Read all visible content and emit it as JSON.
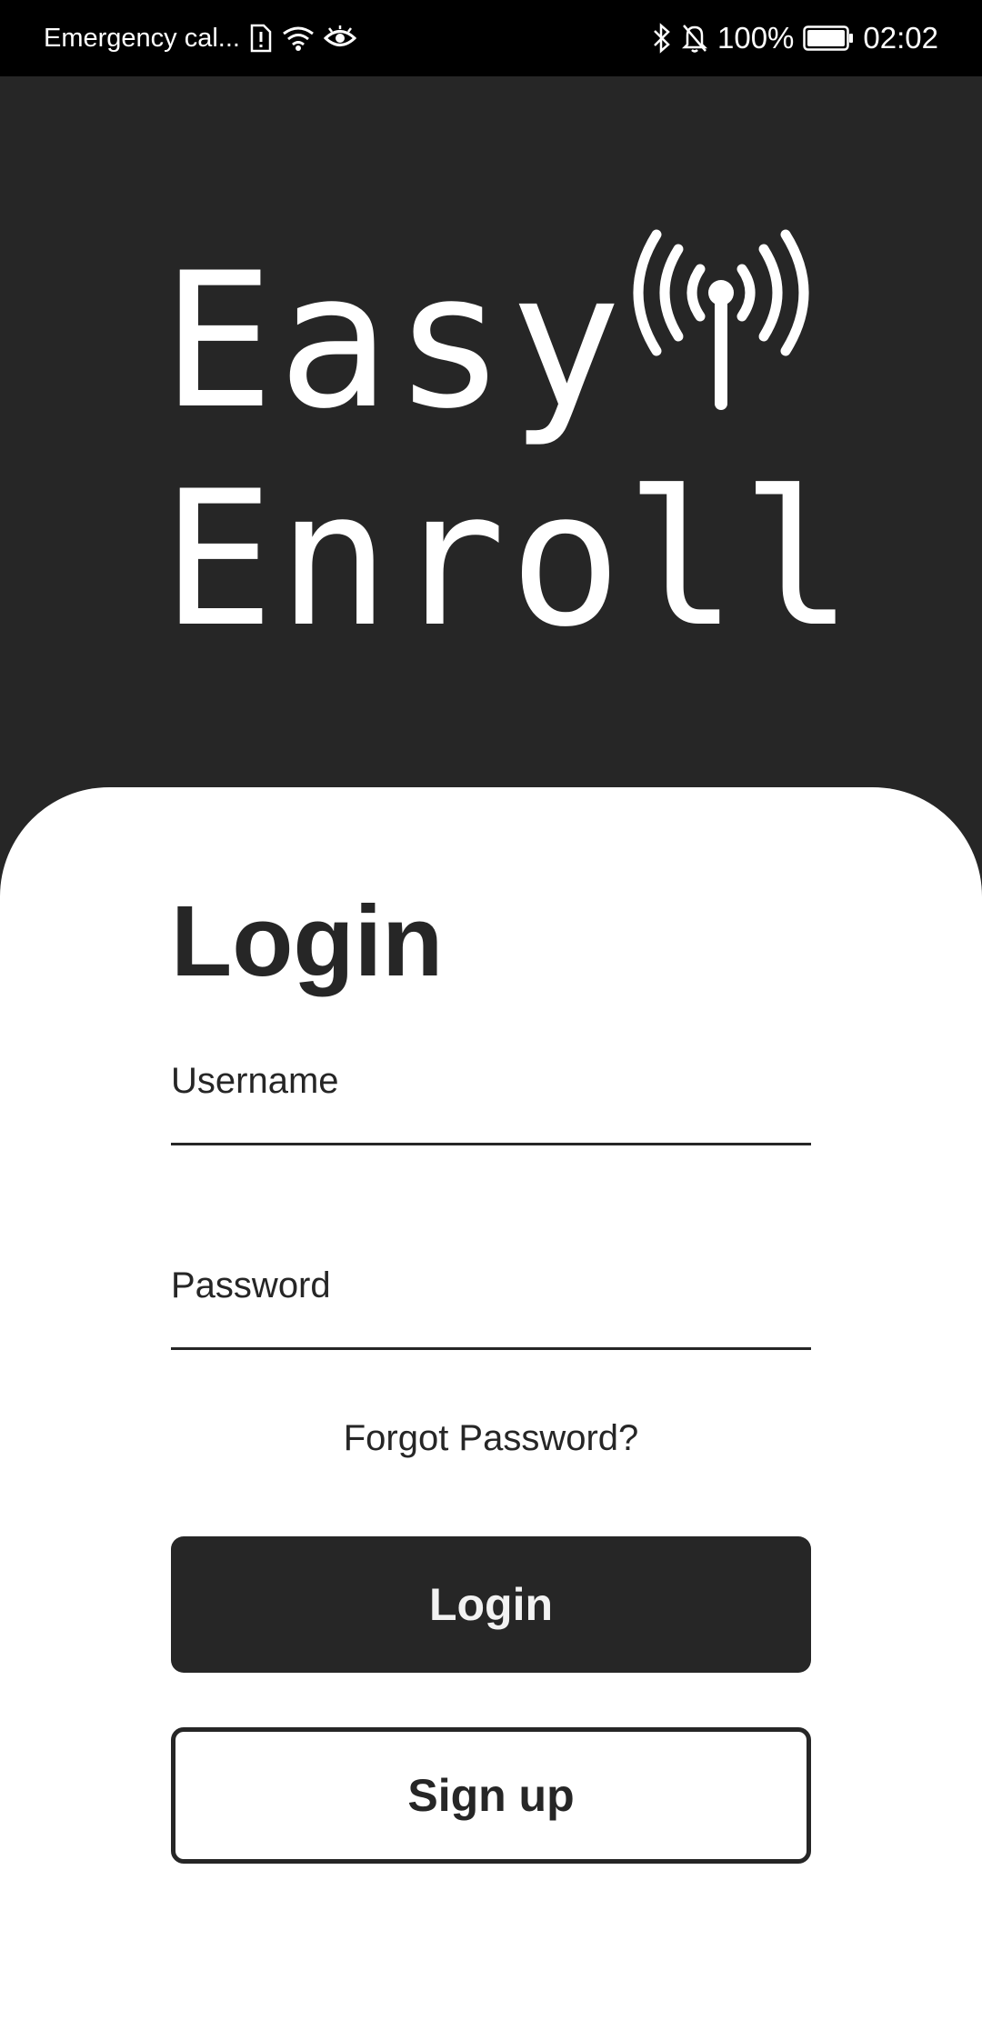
{
  "status_bar": {
    "carrier": "Emergency cal...",
    "battery": "100%",
    "time": "02:02",
    "icons": [
      "sim-alert-icon",
      "wifi-icon",
      "eye-icon",
      "bluetooth-icon",
      "bell-off-icon",
      "battery-icon"
    ]
  },
  "header": {
    "logo_line1": "Easy",
    "logo_line2": "Enroll",
    "logo_icon": "antenna-icon"
  },
  "login_form": {
    "title": "Login",
    "username_placeholder": "Username",
    "password_placeholder": "Password",
    "forgot_password": "Forgot Password?",
    "login_button": "Login",
    "signup_button": "Sign up"
  },
  "colors": {
    "background_dark": "#262626",
    "status_bar": "#000000",
    "card": "#ffffff",
    "text_dark": "#262626",
    "text_light": "#ffffff"
  }
}
